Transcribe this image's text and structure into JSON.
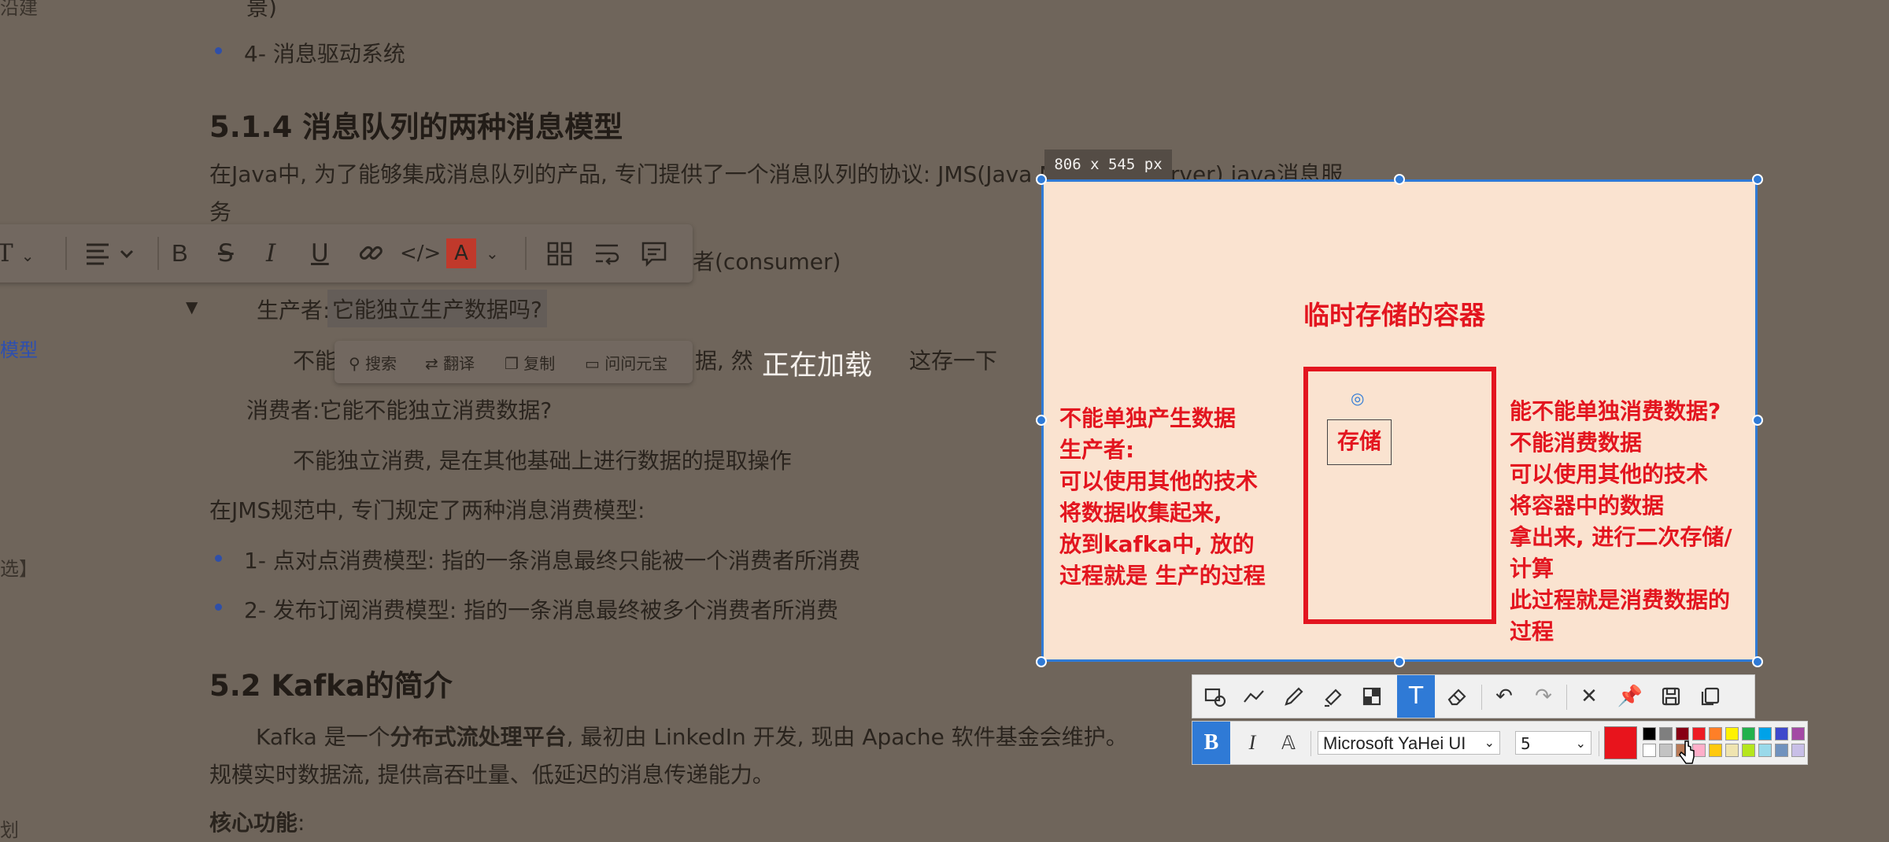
{
  "document": {
    "top_fragment": "景)",
    "bullet_4": "4- 消息驱动系统",
    "heading_514": "5.1.4 消息队列的两种消息模型",
    "para_jms_line1": "在Java中, 为了能够集成消息队列的产品, 专门提供了一个消息队列的协议: JMS(Java Message Server) java消息服",
    "para_jms_line2": "务",
    "consumer_fragment": "者(consumer)",
    "producer_q": "生产者:",
    "producer_q_highlight": "它能独立生产数据吗?",
    "producer_answer_start": "不能",
    "producer_answer_end": "据, 然",
    "producer_answer_tail": "这存一下",
    "consumer_q": "消费者:它能不能独立消费数据?",
    "consumer_answer": "不能独立消费, 是在其他基础上进行数据的提取操作",
    "jms_models_intro": "在JMS规范中, 专门规定了两种消息消费模型:",
    "model_1": "1- 点对点消费模型: 指的一条消息最终只能被一个消费者所消费",
    "model_2": "2- 发布订阅消费模型: 指的一条消息最终被多个消费者所消费",
    "heading_52": "5.2 Kafka的简介",
    "kafka_line1_a": "Kafka 是一个",
    "kafka_line1_bold": "分布式流处理平台",
    "kafka_line1_b": ", 最初由 LinkedIn 开发, 现由 Apache 软件基金会维护。",
    "kafka_line2": "规模实时数据流, 提供高吞吐量、低延迟的消息传递能力。",
    "core_features": "核心功能",
    "core_colon": ":",
    "loading": "正在加载"
  },
  "left_edge": {
    "frag_top": "沿建",
    "frag_model": "模型",
    "frag_select": "选】",
    "frag_bottom": "划"
  },
  "format_toolbar": {
    "text_style": "T",
    "bold": "B",
    "strike": "S",
    "italic": "I",
    "underline": "U",
    "code": "</>",
    "font_color": "A",
    "font_color_hex": "#c0392b"
  },
  "selection_toolbar": {
    "search": "搜索",
    "translate": "翻译",
    "copy": "复制",
    "ask": "问问元宝"
  },
  "capture": {
    "size_label": "806 x 545  px",
    "title": "临时存储的容器",
    "storage_label": "存储",
    "left_lines": [
      "不能单独产生数据",
      "生产者:",
      "可以使用其他的技术",
      "将数据收集起来,",
      "放到kafka中, 放的",
      "过程就是 生产的过程"
    ],
    "right_lines": [
      "能不能单独消费数据?",
      "不能消费数据",
      "可以使用其他的技术",
      "将容器中的数据",
      "拿出来, 进行二次存储/",
      "计算",
      "此过程就是消费数据的",
      "过程"
    ],
    "accent": "#e3151f",
    "frame": "#2f7ad6"
  },
  "annotation_toolbar": {
    "font_name": "Microsoft YaHei UI",
    "font_size": "5",
    "bold": "B",
    "italic": "I",
    "selected_color": "#e8141c",
    "palette_top": [
      "#000000",
      "#7f7f7f",
      "#880015",
      "#ed1c24",
      "#ff7f27",
      "#fff200",
      "#22b14c",
      "#00a2e8",
      "#3f48cc",
      "#a349a4"
    ],
    "palette_bottom": [
      "#ffffff",
      "#c3c3c3",
      "#b97a57",
      "#ffaec9",
      "#ffc90e",
      "#efe4b0",
      "#b5e61d",
      "#99d9ea",
      "#7092be",
      "#c8bfe7"
    ]
  }
}
